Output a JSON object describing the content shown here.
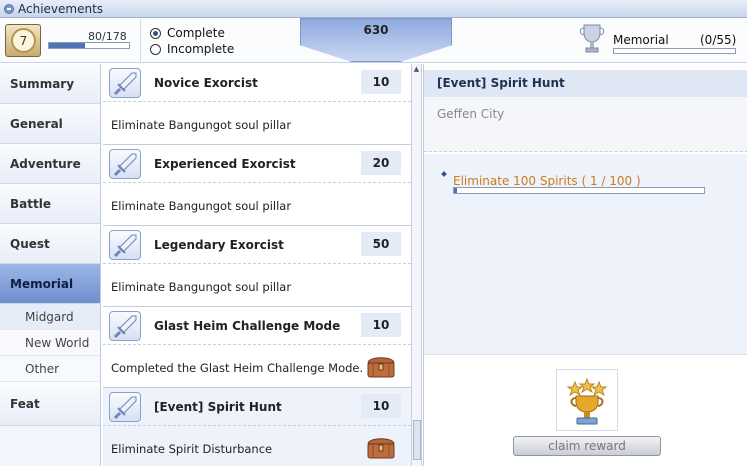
{
  "window": {
    "title": "Achievements"
  },
  "header": {
    "level": "7",
    "level_progress": "80/178",
    "level_fraction": 0.45,
    "filters": [
      {
        "label": "Complete",
        "selected": true
      },
      {
        "label": "Incomplete",
        "selected": false
      }
    ],
    "score": "630",
    "memorial_label": "Memorial",
    "memorial_count": "(0/55)",
    "memorial_fraction": 0
  },
  "sidebar": {
    "items": [
      {
        "label": "Summary"
      },
      {
        "label": "General"
      },
      {
        "label": "Adventure"
      },
      {
        "label": "Battle"
      },
      {
        "label": "Quest"
      },
      {
        "label": "Memorial",
        "active": true
      }
    ],
    "subitems": [
      {
        "label": "Midgard",
        "selected": true
      },
      {
        "label": "New World"
      },
      {
        "label": "Other"
      }
    ],
    "last_item": {
      "label": "Feat"
    }
  },
  "achievements": [
    {
      "name": "Novice Exorcist",
      "points": "10",
      "description": "Eliminate Bangungot soul pillar",
      "icon": "sword-icon",
      "reward": false
    },
    {
      "name": "Experienced Exorcist",
      "points": "20",
      "description": "Eliminate Bangungot soul pillar",
      "icon": "sword-icon",
      "reward": false
    },
    {
      "name": "Legendary Exorcist",
      "points": "50",
      "description": "Eliminate Bangungot soul pillar",
      "icon": "sword-icon",
      "reward": false
    },
    {
      "name": "Glast Heim Challenge Mode",
      "points": "10",
      "description": "Completed the Glast Heim Challenge Mode.",
      "icon": "sword-icon",
      "reward": true
    },
    {
      "name": "[Event] Spirit Hunt",
      "points": "10",
      "description": "Eliminate Spirit Disturbance",
      "icon": "sword-icon",
      "reward": true,
      "selected": true
    }
  ],
  "detail": {
    "title": "[Event] Spirit Hunt",
    "location": "Geffen City",
    "objective": "Eliminate 100 Spirits ( 1 / 100 )",
    "objective_fraction": 0.01,
    "claim_label": "claim reward"
  },
  "colors": {
    "accent": "#4f73b4",
    "objective": "#d07a1a",
    "active_tab": "#7e9dd8"
  }
}
